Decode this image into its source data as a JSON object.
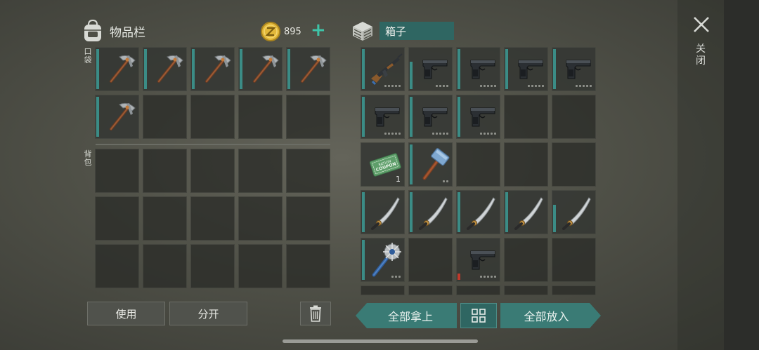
{
  "inventory": {
    "title": "物品栏",
    "coins": "895",
    "coin_icon": "z-coin-icon",
    "plus_label": "+",
    "pockets_label": "口袋",
    "backpack_label": "背包",
    "pockets": [
      {
        "item": "pickaxe",
        "bar": "full",
        "count": ""
      },
      {
        "item": "pickaxe",
        "bar": "full",
        "count": ""
      },
      {
        "item": "pickaxe",
        "bar": "full",
        "count": ""
      },
      {
        "item": "pickaxe",
        "bar": "full",
        "count": ""
      },
      {
        "item": "pickaxe",
        "bar": "full",
        "count": ""
      },
      {
        "item": "pickaxe",
        "bar": "full",
        "count": ""
      },
      {
        "item": "",
        "bar": "",
        "count": ""
      },
      {
        "item": "",
        "bar": "",
        "count": ""
      },
      {
        "item": "",
        "bar": "",
        "count": ""
      },
      {
        "item": "",
        "bar": "",
        "count": ""
      }
    ],
    "backpack_slots": 15
  },
  "box": {
    "title": "箱子",
    "slots": [
      {
        "item": "rifle",
        "bar": "full",
        "count": "",
        "dots": 5
      },
      {
        "item": "pistol",
        "bar": "short",
        "count": "",
        "dots": 4
      },
      {
        "item": "pistol",
        "bar": "full",
        "count": "",
        "dots": 5
      },
      {
        "item": "pistol",
        "bar": "full",
        "count": "",
        "dots": 5
      },
      {
        "item": "pistol",
        "bar": "full",
        "count": "",
        "dots": 5
      },
      {
        "item": "pistol",
        "bar": "full",
        "count": "",
        "dots": 5
      },
      {
        "item": "pistol",
        "bar": "full",
        "count": "",
        "dots": 5
      },
      {
        "item": "pistol",
        "bar": "full",
        "count": "",
        "dots": 5
      },
      {
        "item": "",
        "bar": "",
        "count": "",
        "dots": 0
      },
      {
        "item": "",
        "bar": "",
        "count": "",
        "dots": 0
      },
      {
        "item": "coupon",
        "bar": "",
        "count": "1",
        "dots": 0
      },
      {
        "item": "hammer",
        "bar": "full",
        "count": "",
        "dots": 2
      },
      {
        "item": "",
        "bar": "",
        "count": "",
        "dots": 0
      },
      {
        "item": "",
        "bar": "",
        "count": "",
        "dots": 0
      },
      {
        "item": "",
        "bar": "",
        "count": "",
        "dots": 0
      },
      {
        "item": "sword",
        "bar": "full",
        "count": "",
        "dots": 0
      },
      {
        "item": "sword",
        "bar": "full",
        "count": "",
        "dots": 0
      },
      {
        "item": "sword",
        "bar": "full",
        "count": "",
        "dots": 0
      },
      {
        "item": "sword",
        "bar": "full",
        "count": "",
        "dots": 0
      },
      {
        "item": "sword",
        "bar": "short",
        "count": "",
        "dots": 0
      },
      {
        "item": "mace",
        "bar": "full",
        "count": "",
        "dots": 3
      },
      {
        "item": "",
        "bar": "",
        "count": "",
        "dots": 0
      },
      {
        "item": "pistol",
        "bar": "red",
        "count": "",
        "dots": 5
      },
      {
        "item": "",
        "bar": "",
        "count": "",
        "dots": 0
      },
      {
        "item": "",
        "bar": "",
        "count": "",
        "dots": 0
      }
    ]
  },
  "coupon_text": {
    "line1": "RATION",
    "line2": "COUPON"
  },
  "buttons": {
    "use": "使用",
    "split": "分开",
    "take_all": "全部拿上",
    "put_all": "全部放入"
  },
  "close": {
    "label": "关闭"
  },
  "colors": {
    "accent": "#3b8c86",
    "accent_dark": "#2f6662",
    "plus": "#3ec3a8",
    "coin": "#e2b83a",
    "durability_low": "#c0392b"
  }
}
